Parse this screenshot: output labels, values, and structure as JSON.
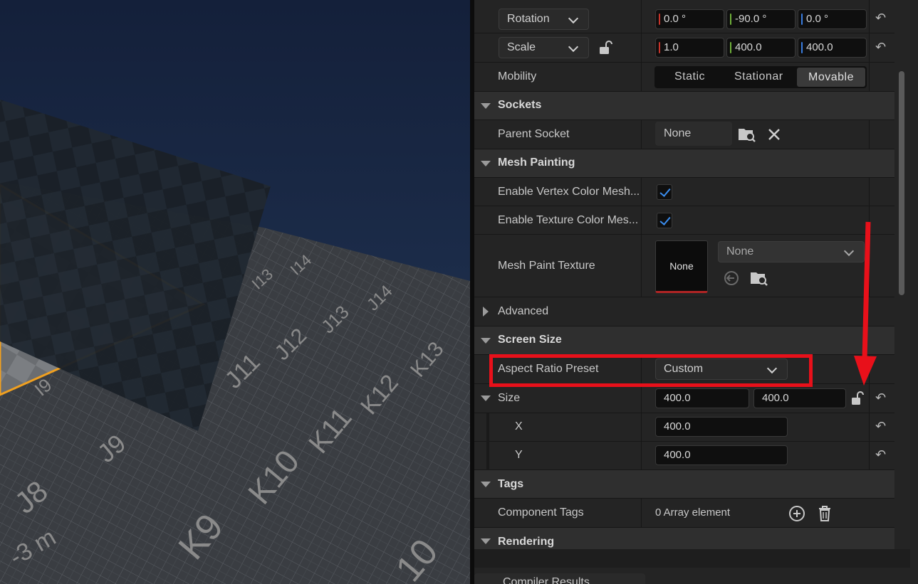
{
  "viewport": {
    "grid_labels": [
      "I13",
      "I14",
      "J13",
      "J14",
      "J12",
      "K13",
      "J11",
      "K12",
      "I9",
      "J9",
      "K11",
      "J8",
      "K10",
      "K9",
      "10"
    ],
    "distance_label": "-3 m"
  },
  "details": {
    "rotation": {
      "label": "Rotation",
      "x": "0.0 °",
      "y": "-90.0 °",
      "z": "0.0 °"
    },
    "scale": {
      "label": "Scale",
      "x": "1.0",
      "y": "400.0",
      "z": "400.0"
    },
    "mobility": {
      "label": "Mobility",
      "options": [
        "Static",
        "Stationar",
        "Movable"
      ],
      "selected": "Movable"
    },
    "sockets": {
      "title": "Sockets",
      "parent_socket_label": "Parent Socket",
      "parent_socket_value": "None"
    },
    "mesh_painting": {
      "title": "Mesh Painting",
      "vertex_label": "Enable Vertex Color Mesh...",
      "texture_label": "Enable Texture Color Mes...",
      "paint_texture_label": "Mesh Paint Texture",
      "thumb_text": "None",
      "combo_value": "None"
    },
    "advanced": {
      "title": "Advanced"
    },
    "screen_size": {
      "title": "Screen Size",
      "aspect_label": "Aspect Ratio Preset",
      "aspect_value": "Custom",
      "size_label": "Size",
      "size_x": "400.0",
      "size_y": "400.0",
      "x_label": "X",
      "x_value": "400.0",
      "y_label": "Y",
      "y_value": "400.0"
    },
    "tags": {
      "title": "Tags",
      "component_tags_label": "Component Tags",
      "component_tags_value": "0 Array element"
    },
    "rendering": {
      "title": "Rendering"
    }
  },
  "bottom_tab": {
    "label": "Compiler Results"
  },
  "colors": {
    "axis_x": "#c8342a",
    "axis_y": "#6fb03a",
    "axis_z": "#3a7de0",
    "highlight": "#e8101a",
    "selection_outline": "#f0a020"
  }
}
